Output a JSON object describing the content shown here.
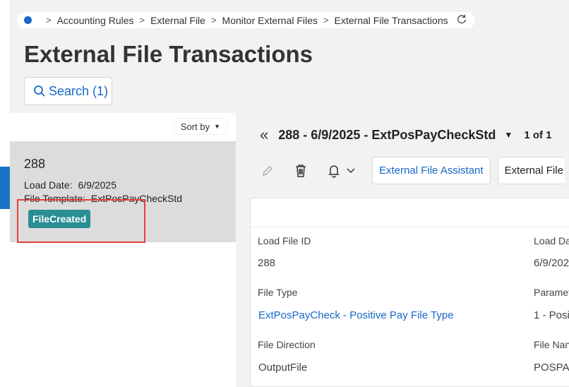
{
  "breadcrumb": {
    "items": [
      "Accounting Rules",
      "External File",
      "Monitor External Files",
      "External File Transactions"
    ]
  },
  "page_title": "External File Transactions",
  "search": {
    "label": "Search (1)"
  },
  "list": {
    "sort_label": "Sort by",
    "item": {
      "id": "288",
      "load_date_label": "Load Date:",
      "load_date_value": "6/9/2025",
      "file_template_label": "File Template:",
      "file_template_value": "ExtPosPayCheckStd",
      "status": "FileCreated"
    }
  },
  "record": {
    "title": "288 - 6/9/2025 - ExtPosPayCheckStd",
    "pager": "1 of 1"
  },
  "toolbar": {
    "assistant_label": "External File Assistant",
    "next_label": "External File"
  },
  "fields": {
    "load_file_id_label": "Load File ID",
    "load_file_id_value": "288",
    "load_date_label": "Load Da",
    "load_date_value": "6/9/202",
    "file_type_label": "File Type",
    "file_type_value": "ExtPosPayCheck - Positive Pay File Type",
    "parameter_label": "Paramet",
    "parameter_value": "1 - Posi",
    "file_direction_label": "File Direction",
    "file_direction_value": "OutputFile",
    "file_name_label": "File Nan",
    "file_name_value": "POSPAY"
  },
  "colors": {
    "accent": "#1768c9",
    "badge": "#2a8e95",
    "highlight": "#e0403f"
  }
}
